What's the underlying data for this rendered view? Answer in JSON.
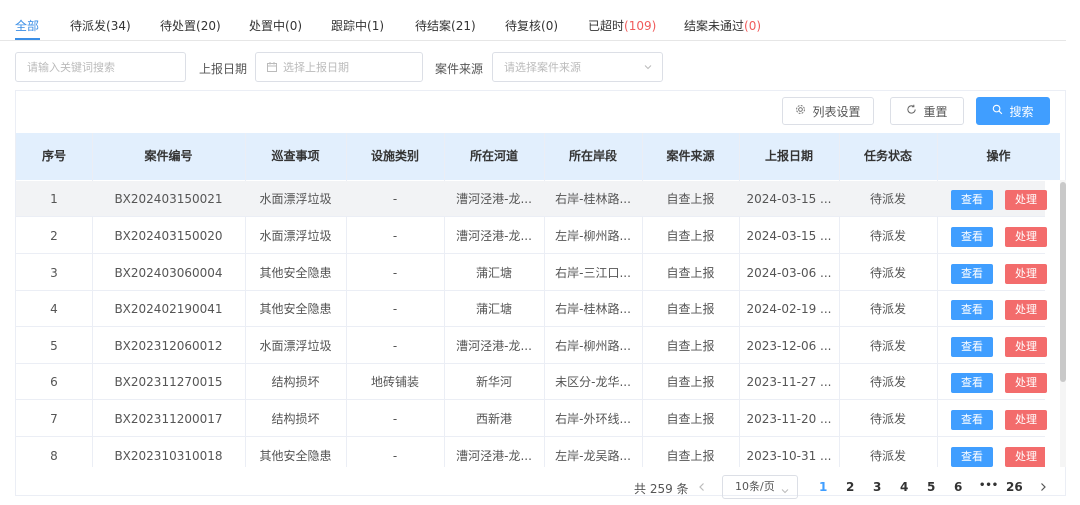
{
  "tabs": [
    {
      "label": "全部",
      "count": ""
    },
    {
      "label": "待派发",
      "count": "(34)"
    },
    {
      "label": "待处置",
      "count": "(20)"
    },
    {
      "label": "处置中",
      "count": "(0)"
    },
    {
      "label": "跟踪中",
      "count": "(1)"
    },
    {
      "label": "待结案",
      "count": "(21)"
    },
    {
      "label": "待复核",
      "count": "(0)"
    },
    {
      "label": "已超时",
      "count": "(109)"
    },
    {
      "label": "结案未通过",
      "count": "(0)"
    }
  ],
  "filters": {
    "keyword_placeholder": "请输入关键词搜索",
    "date_label": "上报日期",
    "date_placeholder": "选择上报日期",
    "source_label": "案件来源",
    "source_placeholder": "请选择案件来源"
  },
  "toolbar": {
    "column_settings": "列表设置",
    "reset": "重置",
    "search": "搜索"
  },
  "table": {
    "headers": [
      "序号",
      "案件编号",
      "巡查事项",
      "设施类别",
      "所在河道",
      "所在岸段",
      "案件来源",
      "上报日期",
      "任务状态",
      "操作"
    ],
    "view_label": "查看",
    "handle_label": "处理",
    "rows": [
      [
        "1",
        "BX202403150021",
        "水面漂浮垃圾",
        "-",
        "漕河泾港-龙...",
        "右岸-桂林路...",
        "自查上报",
        "2024-03-15 ...",
        "待派发"
      ],
      [
        "2",
        "BX202403150020",
        "水面漂浮垃圾",
        "-",
        "漕河泾港-龙...",
        "左岸-柳州路...",
        "自查上报",
        "2024-03-15 ...",
        "待派发"
      ],
      [
        "3",
        "BX202403060004",
        "其他安全隐患",
        "-",
        "蒲汇塘",
        "右岸-三江口...",
        "自查上报",
        "2024-03-06 ...",
        "待派发"
      ],
      [
        "4",
        "BX202402190041",
        "其他安全隐患",
        "-",
        "蒲汇塘",
        "右岸-桂林路...",
        "自查上报",
        "2024-02-19 ...",
        "待派发"
      ],
      [
        "5",
        "BX202312060012",
        "水面漂浮垃圾",
        "-",
        "漕河泾港-龙...",
        "右岸-柳州路...",
        "自查上报",
        "2023-12-06 ...",
        "待派发"
      ],
      [
        "6",
        "BX202311270015",
        "结构损坏",
        "地砖铺装",
        "新华河",
        "未区分-龙华...",
        "自查上报",
        "2023-11-27 ...",
        "待派发"
      ],
      [
        "7",
        "BX202311200017",
        "结构损坏",
        "-",
        "西新港",
        "右岸-外环线...",
        "自查上报",
        "2023-11-20 ...",
        "待派发"
      ],
      [
        "8",
        "BX202310310018",
        "其他安全隐患",
        "-",
        "漕河泾港-龙...",
        "左岸-龙吴路...",
        "自查上报",
        "2023-10-31 ...",
        "待派发"
      ]
    ]
  },
  "pagination": {
    "total_text": "共 259 条",
    "page_size": "10条/页",
    "pages": [
      "1",
      "2",
      "3",
      "4",
      "5",
      "6",
      "•••",
      "26"
    ],
    "current": "1"
  },
  "colors": {
    "accent": "#409eff",
    "danger": "#f36c6c",
    "header_bg": "#e2effd"
  }
}
